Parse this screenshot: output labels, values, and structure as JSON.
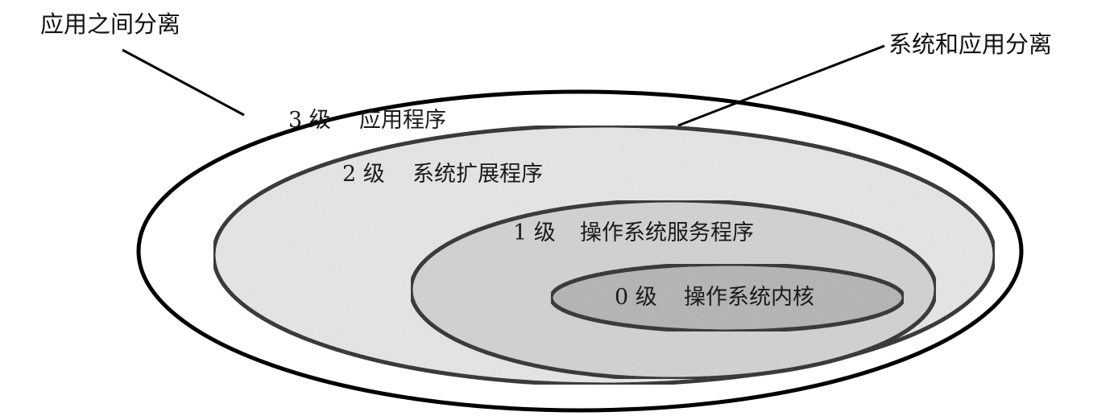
{
  "callouts": {
    "app_isolation": "应用之间分离",
    "system_app_isolation": "系统和应用分离"
  },
  "rings": [
    {
      "level": "3 级",
      "name": "应用程序",
      "fill": "#ffffff"
    },
    {
      "level": "2 级",
      "name": "系统扩展程序",
      "fill": "#e6e6e6"
    },
    {
      "level": "1 级",
      "name": "操作系统服务程序",
      "fill": "#d2d2d2"
    },
    {
      "level": "0 级",
      "name": "操作系统内核",
      "fill": "#b4b4b4"
    }
  ],
  "colors": {
    "outline": "#000000",
    "background": "#ffffff"
  }
}
